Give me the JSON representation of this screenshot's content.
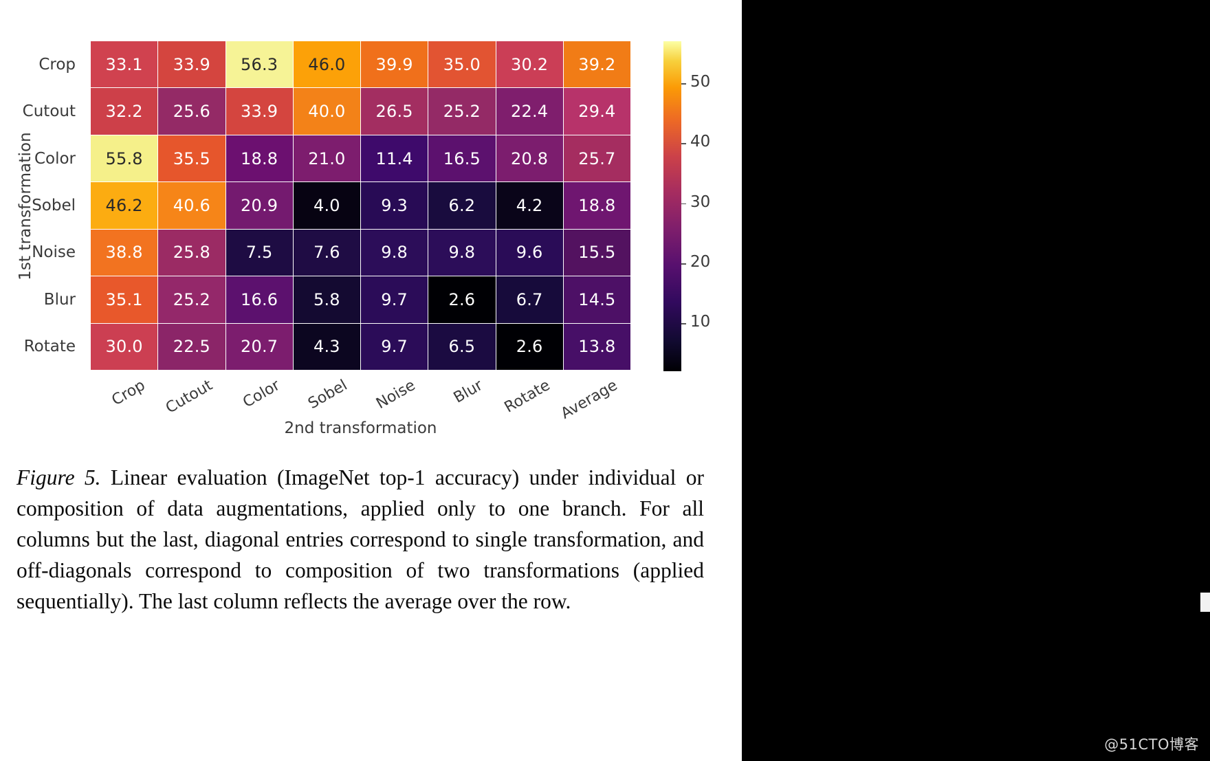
{
  "watermark": "@51CTO博客",
  "figure": {
    "xlabel": "2nd transformation",
    "ylabel": "1st transformation"
  },
  "chart_data": {
    "type": "heatmap",
    "title": "",
    "xlabel": "2nd transformation",
    "ylabel": "1st transformation",
    "colormap": "inferno",
    "colorbar": {
      "ticks": [
        10,
        20,
        30,
        40,
        50
      ],
      "tick_labels": [
        "10",
        "20",
        "30",
        "40",
        "50"
      ],
      "vmin": 2.6,
      "vmax": 56.3,
      "position": "right"
    },
    "x_categories": [
      "Crop",
      "Cutout",
      "Color",
      "Sobel",
      "Noise",
      "Blur",
      "Rotate",
      "Average"
    ],
    "y_categories": [
      "Crop",
      "Cutout",
      "Color",
      "Sobel",
      "Noise",
      "Blur",
      "Rotate"
    ],
    "rows": [
      {
        "label": "Crop",
        "values": [
          33.1,
          33.9,
          56.3,
          46.0,
          39.9,
          35.0,
          30.2,
          39.2
        ]
      },
      {
        "label": "Cutout",
        "values": [
          32.2,
          25.6,
          33.9,
          40.0,
          26.5,
          25.2,
          22.4,
          29.4
        ]
      },
      {
        "label": "Color",
        "values": [
          55.8,
          35.5,
          18.8,
          21.0,
          11.4,
          16.5,
          20.8,
          25.7
        ]
      },
      {
        "label": "Sobel",
        "values": [
          46.2,
          40.6,
          20.9,
          4.0,
          9.3,
          6.2,
          4.2,
          18.8
        ]
      },
      {
        "label": "Noise",
        "values": [
          38.8,
          25.8,
          7.5,
          7.6,
          9.8,
          9.8,
          9.6,
          15.5
        ]
      },
      {
        "label": "Blur",
        "values": [
          35.1,
          25.2,
          16.6,
          5.8,
          9.7,
          2.6,
          6.7,
          14.5
        ]
      },
      {
        "label": "Rotate",
        "values": [
          30.0,
          22.5,
          20.7,
          4.3,
          9.7,
          6.5,
          2.6,
          13.8
        ]
      }
    ],
    "cell_labels": [
      [
        "33.1",
        "33.9",
        "56.3",
        "46.0",
        "39.9",
        "35.0",
        "30.2",
        "39.2"
      ],
      [
        "32.2",
        "25.6",
        "33.9",
        "40.0",
        "26.5",
        "25.2",
        "22.4",
        "29.4"
      ],
      [
        "55.8",
        "35.5",
        "18.8",
        "21.0",
        "11.4",
        "16.5",
        "20.8",
        "25.7"
      ],
      [
        "46.2",
        "40.6",
        "20.9",
        "4.0",
        "9.3",
        "6.2",
        "4.2",
        "18.8"
      ],
      [
        "38.8",
        "25.8",
        "7.5",
        "7.6",
        "9.8",
        "9.8",
        "9.6",
        "15.5"
      ],
      [
        "35.1",
        "25.2",
        "16.6",
        "5.8",
        "9.7",
        "2.6",
        "6.7",
        "14.5"
      ],
      [
        "30.0",
        "22.5",
        "20.7",
        "4.3",
        "9.7",
        "6.5",
        "2.6",
        "13.8"
      ]
    ],
    "cell_colors": [
      [
        "#d0424f",
        "#d4453f",
        "#f6f396",
        "#fca108",
        "#f0701b",
        "#e25432",
        "#cb3e56",
        "#f17c16"
      ],
      [
        "#cd4049",
        "#942a66",
        "#d4453f",
        "#f38218",
        "#a32e61",
        "#942a66",
        "#7f1e6d",
        "#b7336a"
      ],
      [
        "#f5f08a",
        "#e6562c",
        "#6c1070",
        "#7d1d6e",
        "#3e0a6b",
        "#5c116e",
        "#7c1d6e",
        "#a52d60"
      ],
      [
        "#fcac11",
        "#f68518",
        "#741a6f",
        "#070312",
        "#280b55",
        "#190c3e",
        "#0a0519",
        "#6f1670"
      ],
      [
        "#f27320",
        "#9b2b64",
        "#1e0c43",
        "#1f0c44",
        "#2c0d59",
        "#2c0d59",
        "#2a0c57",
        "#531260"
      ],
      [
        "#e8582b",
        "#94286a",
        "#5c116e",
        "#140a31",
        "#2b0c58",
        "#000004",
        "#170b3b",
        "#4d1066"
      ],
      [
        "#cc3f52",
        "#8b2568",
        "#7c1d6e",
        "#0c0620",
        "#2b0c58",
        "#1b0b41",
        "#000004",
        "#470f67"
      ]
    ],
    "cell_text_colors": [
      [
        "#ffffff",
        "#ffffff",
        "#2a2a2a",
        "#2a2a2a",
        "#ffffff",
        "#ffffff",
        "#ffffff",
        "#ffffff"
      ],
      [
        "#ffffff",
        "#ffffff",
        "#ffffff",
        "#ffffff",
        "#ffffff",
        "#ffffff",
        "#ffffff",
        "#ffffff"
      ],
      [
        "#2a2a2a",
        "#ffffff",
        "#ffffff",
        "#ffffff",
        "#ffffff",
        "#ffffff",
        "#ffffff",
        "#ffffff"
      ],
      [
        "#2a2a2a",
        "#ffffff",
        "#ffffff",
        "#ffffff",
        "#ffffff",
        "#ffffff",
        "#ffffff",
        "#ffffff"
      ],
      [
        "#ffffff",
        "#ffffff",
        "#ffffff",
        "#ffffff",
        "#ffffff",
        "#ffffff",
        "#ffffff",
        "#ffffff"
      ],
      [
        "#ffffff",
        "#ffffff",
        "#ffffff",
        "#ffffff",
        "#ffffff",
        "#ffffff",
        "#ffffff",
        "#ffffff"
      ],
      [
        "#ffffff",
        "#ffffff",
        "#ffffff",
        "#ffffff",
        "#ffffff",
        "#ffffff",
        "#ffffff",
        "#ffffff"
      ]
    ]
  },
  "caption": {
    "figure_number": "Figure 5.",
    "text": " Linear evaluation (ImageNet top-1 accuracy) under individual or composition of data augmentations, applied only to one branch. For all columns but the last, diagonal entries correspond to single transformation, and off-diagonals correspond to composition of two transformations (applied sequentially). The last column reflects the average over the row."
  }
}
